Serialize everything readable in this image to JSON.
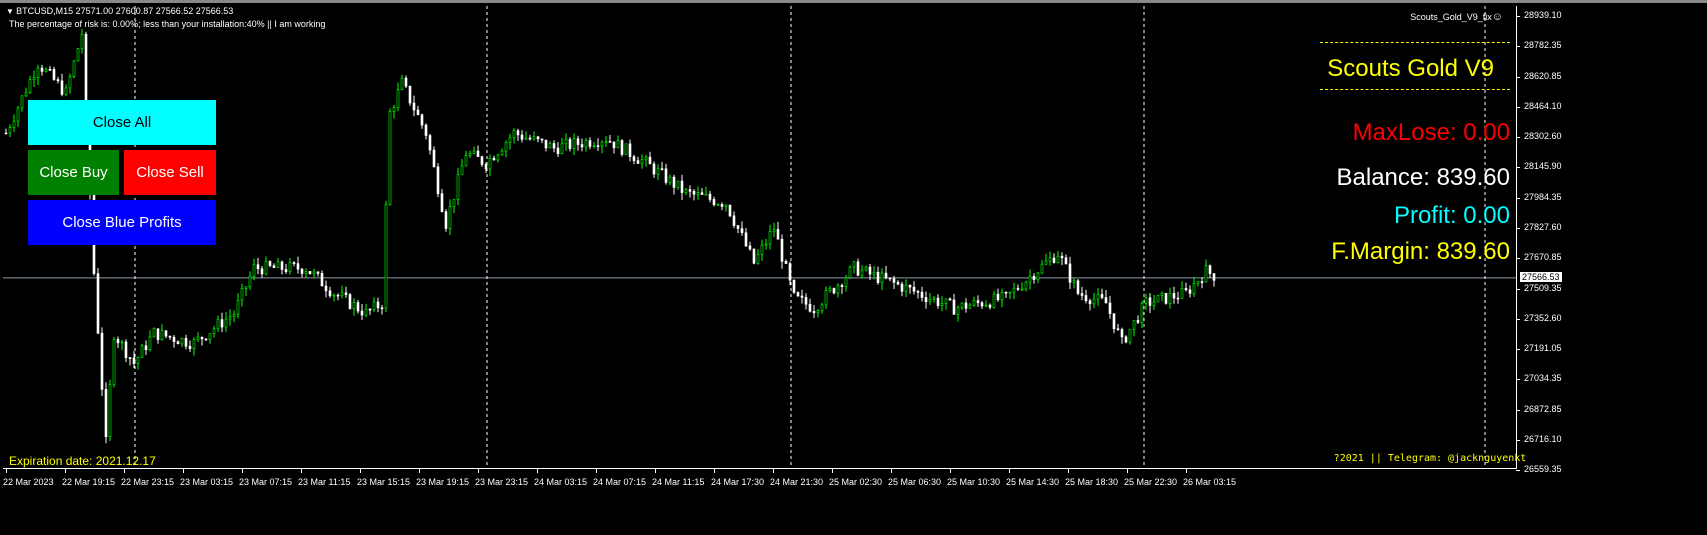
{
  "header": {
    "symbol_line": "BTCUSD,M15  27571.00 27600.87 27566.52 27566.53",
    "risk_line": "The percentage of risk is: 0.00%; less than your installation:40%  || I am working",
    "indicator": "Scouts_Gold_V9_fix"
  },
  "buttons": {
    "close_all": "Close All",
    "close_buy": "Close Buy",
    "close_sell": "Close Sell",
    "close_blue": "Close Blue Profits"
  },
  "panel": {
    "title": "Scouts Gold V9",
    "max_lose": "MaxLose: 0.00",
    "balance": "Balance: 839.60",
    "profit": "Profit: 0.00",
    "margin": "F.Margin: 839.60"
  },
  "footer": {
    "expiration": "Expiration date: 2021.12.17",
    "telegram": "?2021  || Telegram: @jacknguyenkt"
  },
  "colors": {
    "bull": "#00ff00",
    "bear": "#ffffff",
    "yellow": "#ffff00",
    "red": "#ff0000",
    "cyan": "#00ffff"
  },
  "chart_data": {
    "type": "candlestick",
    "current_price": "27566.53",
    "price_ticks": [
      "28939.10",
      "28782.35",
      "28620.85",
      "28464.10",
      "28302.60",
      "28145.90",
      "27984.35",
      "27827.60",
      "27670.85",
      "27509.35",
      "27352.60",
      "27191.05",
      "27034.35",
      "26872.85",
      "26716.10",
      "26559.35"
    ],
    "time_ticks": [
      "22 Mar 2023",
      "22 Mar 19:15",
      "22 Mar 23:15",
      "23 Mar 03:15",
      "23 Mar 07:15",
      "23 Mar 11:15",
      "23 Mar 15:15",
      "23 Mar 19:15",
      "23 Mar 23:15",
      "24 Mar 03:15",
      "24 Mar 07:15",
      "24 Mar 11:15",
      "24 Mar 17:30",
      "24 Mar 21:30",
      "25 Mar 02:30",
      "25 Mar 06:30",
      "25 Mar 10:30",
      "25 Mar 14:30",
      "25 Mar 18:30",
      "25 Mar 22:30",
      "26 Mar 03:15"
    ],
    "ylim": [
      26559.35,
      28939.1
    ],
    "close_path": [
      [
        0,
        28326
      ],
      [
        8,
        28693
      ],
      [
        15,
        28535
      ],
      [
        19,
        28850
      ],
      [
        22,
        27592
      ],
      [
        25,
        26701
      ],
      [
        27,
        27277
      ],
      [
        32,
        27120
      ],
      [
        37,
        27277
      ],
      [
        47,
        27225
      ],
      [
        57,
        27382
      ],
      [
        62,
        27618
      ],
      [
        75,
        27618
      ],
      [
        82,
        27487
      ],
      [
        90,
        27382
      ],
      [
        94,
        27434
      ],
      [
        96,
        28431
      ],
      [
        99,
        28588
      ],
      [
        105,
        28326
      ],
      [
        110,
        27854
      ],
      [
        115,
        28221
      ],
      [
        120,
        28168
      ],
      [
        127,
        28326
      ],
      [
        137,
        28247
      ],
      [
        150,
        28300
      ],
      [
        160,
        28168
      ],
      [
        170,
        28011
      ],
      [
        180,
        27959
      ],
      [
        187,
        27644
      ],
      [
        192,
        27828
      ],
      [
        197,
        27461
      ],
      [
        202,
        27409
      ],
      [
        212,
        27618
      ],
      [
        225,
        27513
      ],
      [
        237,
        27409
      ],
      [
        250,
        27461
      ],
      [
        257,
        27592
      ],
      [
        263,
        27697
      ],
      [
        268,
        27487
      ],
      [
        275,
        27434
      ],
      [
        279,
        27225
      ],
      [
        285,
        27434
      ],
      [
        295,
        27487
      ],
      [
        300,
        27602
      ],
      [
        302,
        27581
      ]
    ]
  }
}
